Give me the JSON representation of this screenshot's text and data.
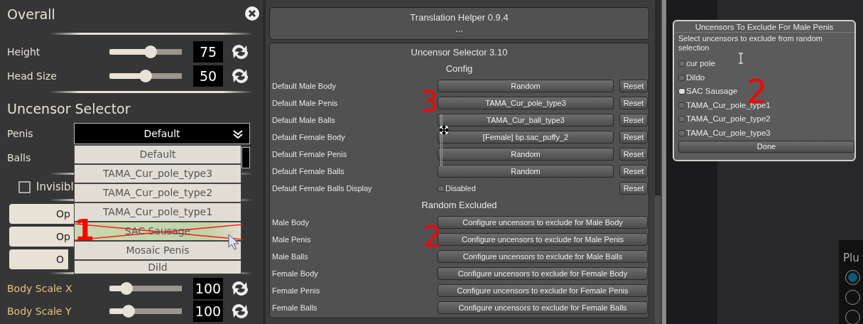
{
  "left_panel": {
    "title": "Overall",
    "top_sliders": [
      {
        "label": "Height",
        "level": 0.57,
        "value": "75"
      },
      {
        "label": "Head Size",
        "level": 0.5,
        "value": "50"
      }
    ],
    "section_title": "Uncensor Selector",
    "selects": [
      {
        "label": "Penis",
        "value": "Default"
      },
      {
        "label": "Balls"
      }
    ],
    "checkbox": {
      "label": "Invisibl",
      "checked": false
    },
    "buttons": [
      "Op",
      "Op",
      "O"
    ],
    "bottom_sliders": [
      {
        "label": "Body Scale X",
        "level": 0.24,
        "value": "100"
      },
      {
        "label": "Body Scale Y",
        "level": 0.26,
        "value": "100"
      }
    ],
    "dropdown_options": [
      {
        "label": "Default",
        "selected": false,
        "crossed_out": false
      },
      {
        "label": "TAMA_Cur_pole_type3",
        "selected": false,
        "crossed_out": false
      },
      {
        "label": "TAMA_Cur_pole_type2",
        "selected": false,
        "crossed_out": false
      },
      {
        "label": "TAMA_Cur_pole_type1",
        "selected": false,
        "crossed_out": false
      },
      {
        "label": "SAC Sausage",
        "selected": true,
        "crossed_out": true
      },
      {
        "label": "Mosaic Penis",
        "selected": false,
        "crossed_out": false
      },
      {
        "label": "Dild",
        "selected": false,
        "crossed_out": false
      }
    ],
    "annotation": "1"
  },
  "translation_helper": {
    "title": "Translation Helper 0.9.4",
    "subtitle": "..."
  },
  "uncensor_selector": {
    "title": "Uncensor Selector 3.10",
    "config_heading": "Config",
    "config_rows": [
      {
        "label": "Default Male Body",
        "kind": "button",
        "value": "Random",
        "reset": "Reset"
      },
      {
        "label": "Default Male Penis",
        "kind": "button",
        "value": "TAMA_Cur_pole_type3",
        "reset": "Reset"
      },
      {
        "label": "Default Male Balls",
        "kind": "button",
        "value": "TAMA_Cur_ball_type3",
        "reset": "Reset"
      },
      {
        "label": "Default Female Body",
        "kind": "button",
        "value": "[Female] bp.sac_puffy_2",
        "reset": "Reset"
      },
      {
        "label": "Default Female Penis",
        "kind": "button",
        "value": "Random",
        "reset": "Reset"
      },
      {
        "label": "Default Female Balls",
        "kind": "button",
        "value": "Random",
        "reset": "Reset"
      },
      {
        "label": "Default Female Balls Display",
        "kind": "checkbox",
        "value": "Disabled",
        "checked": false,
        "reset": "Reset"
      }
    ],
    "excluded_heading": "Random Excluded",
    "excluded_rows": [
      {
        "label": "Male Body",
        "button": "Configure uncensors to exclude for Male Body"
      },
      {
        "label": "Male Penis",
        "button": "Configure uncensors to exclude for Male Penis"
      },
      {
        "label": "Male Balls",
        "button": "Configure uncensors to exclude for Male Balls"
      },
      {
        "label": "Female Body",
        "button": "Configure uncensors to exclude for Female Body"
      },
      {
        "label": "Female Penis",
        "button": "Configure uncensors to exclude for Female Penis"
      },
      {
        "label": "Female Balls",
        "button": "Configure uncensors to exclude for Female Balls"
      }
    ],
    "config_annotation": "3",
    "excluded_annotation": "2"
  },
  "dialog": {
    "title": "Uncensors To Exclude For Male Penis",
    "description": "Select uncensors to exclude from random selection",
    "options": [
      {
        "label": "cur pole",
        "checked": false
      },
      {
        "label": "Dildo",
        "checked": false
      },
      {
        "label": "SAC Sausage",
        "checked": true
      },
      {
        "label": "TAMA_Cur_pole_type1",
        "checked": false
      },
      {
        "label": "TAMA_Cur_pole_type2",
        "checked": false
      },
      {
        "label": "TAMA_Cur_pole_type3",
        "checked": false
      }
    ],
    "done": "Done",
    "annotation": "2"
  },
  "plugin_panel": {
    "title": "Plu",
    "radios": [
      {
        "selected": true
      },
      {
        "selected": false
      },
      {
        "selected": false
      }
    ]
  }
}
